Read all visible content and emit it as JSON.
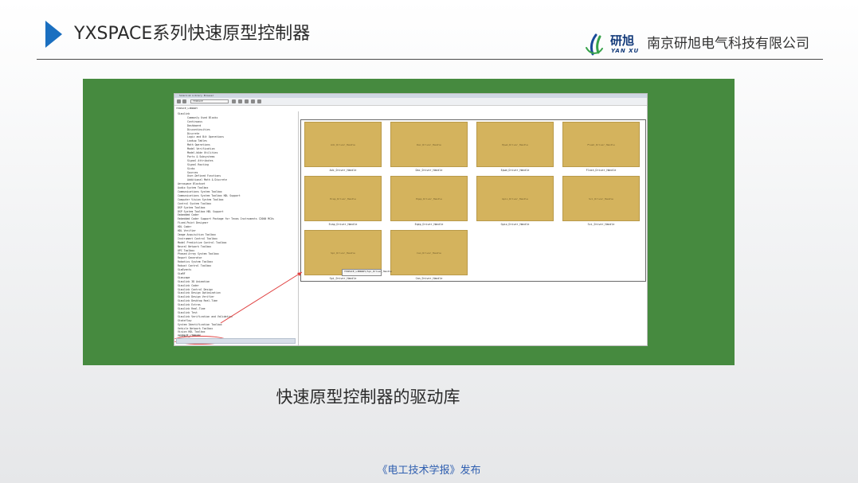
{
  "header": {
    "title": "YXSPACE系列快速原型控制器",
    "logo_cn": "研旭",
    "logo_en": "YAN XU",
    "company": "南京研旭电气科技有限公司",
    "accent_color": "#1a6fc0"
  },
  "screenshot": {
    "window_title": "Simulink Library Browser",
    "address": "YXSPACE",
    "breadcrumb": "YXSPACE_LIBRARY",
    "tree_items": [
      "Simulink",
      "Commonly Used Blocks",
      "Continuous",
      "Dashboard",
      "Discontinuities",
      "Discrete",
      "Logic and Bit Operations",
      "Lookup Tables",
      "Math Operations",
      "Model Verification",
      "Model-Wide Utilities",
      "Ports & Subsystems",
      "Signal Attributes",
      "Signal Routing",
      "Sinks",
      "Sources",
      "User-Defined Functions",
      "Additional Math & Discrete",
      "Aerospace Blockset",
      "Audio System Toolbox",
      "Communications System Toolbox",
      "Communications System Toolbox HDL Support",
      "Computer Vision System Toolbox",
      "Control System Toolbox",
      "DSP System Toolbox",
      "DSP System Toolbox HDL Support",
      "Embedded Coder",
      "Embedded Coder Support Package for Texas Instruments C2000 MCUs",
      "Fixed-Point Designer",
      "HDL Coder",
      "HDL Verifier",
      "Image Acquisition Toolbox",
      "Instrument Control Toolbox",
      "Model Predictive Control Toolbox",
      "Neural Network Toolbox",
      "OPC Toolbox",
      "Phased Array System Toolbox",
      "Report Generator",
      "Robotics System Toolbox",
      "Robust Control Toolbox",
      "SimEvents",
      "SimRF",
      "Simscape",
      "Simulink 3D Animation",
      "Simulink Coder",
      "Simulink Control Design",
      "Simulink Design Optimization",
      "Simulink Design Verifier",
      "Simulink Desktop Real-Time",
      "Simulink Extras",
      "Simulink Real-Time",
      "Simulink Test",
      "Simulink Verification and Validation",
      "Stateflow",
      "System Identification Toolbox",
      "Vehicle Network Toolbox",
      "Vision HDL Toolbox",
      "YXSPACE_LIBRARY"
    ],
    "tiles": [
      {
        "inner": "Adc_Driver_Handle",
        "caption": "Adc_Driver_Handle"
      },
      {
        "inner": "Dac_Driver_Handle",
        "caption": "Dac_Driver_Handle"
      },
      {
        "inner": "Epwm_Driver_Handle",
        "caption": "Epwm_Driver_Handle"
      },
      {
        "inner": "Flash_Driver_Handle",
        "caption": "Flash_Driver_Handle"
      },
      {
        "inner": "Ecap_Driver_Handle",
        "caption": "Ecap_Driver_Handle"
      },
      {
        "inner": "Eqep_Driver_Handle",
        "caption": "Eqep_Driver_Handle"
      },
      {
        "inner": "Gpio_Driver_Handle",
        "caption": "Gpio_Driver_Handle"
      },
      {
        "inner": "Sci_Driver_Handle",
        "caption": "Sci_Driver_Handle"
      },
      {
        "inner": "Spi_Driver_Handle",
        "caption": "Spi_Driver_Handle"
      },
      {
        "inner": "Can_Driver_Handle",
        "caption": "Can_Driver_Handle"
      }
    ],
    "tooltip": "YXSPACE_LIBRARY/Spi_Driver_Handle",
    "tile_color": "#d4b35d",
    "frame_color": "#468a3f"
  },
  "caption": "快速原型控制器的驱动库",
  "footer": "《电工技术学报》发布"
}
